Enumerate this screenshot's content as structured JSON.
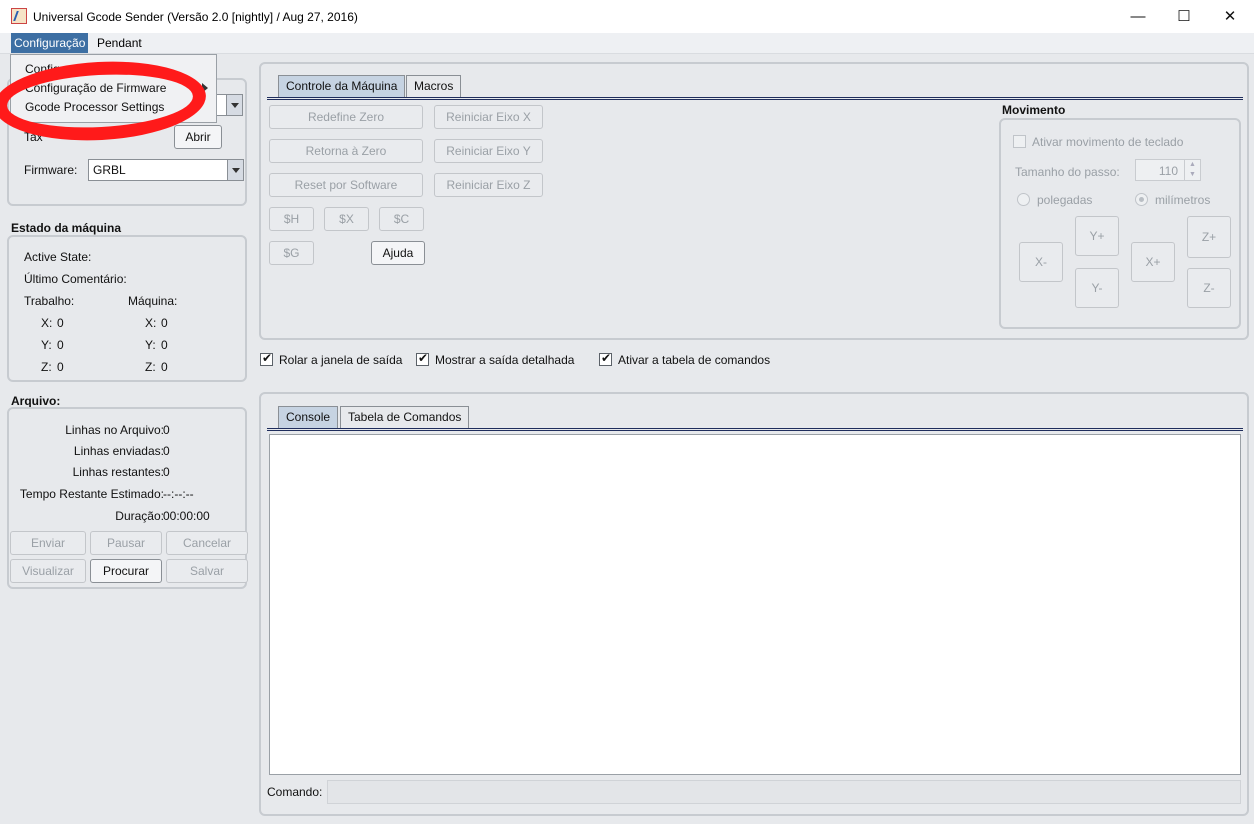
{
  "window": {
    "title": "Universal Gcode Sender (Versão 2.0 [nightly]  / Aug 27, 2016)",
    "minimize_label": "—",
    "maximize_label": "☐",
    "close_label": "✕"
  },
  "menubar": {
    "items": [
      "Configuração",
      "Pendant"
    ]
  },
  "dropdown": {
    "items": [
      "Configuração de Envio",
      "Configuração de Firmware",
      "Gcode Processor Settings"
    ]
  },
  "connection": {
    "port_label": "Tax",
    "open_button": "Abrir",
    "firmware_label": "Firmware:",
    "firmware_value": "GRBL"
  },
  "machine_state": {
    "title": "Estado da máquina",
    "active_state_label": "Active State:",
    "last_comment_label": "Último Comentário:",
    "work_label": "Trabalho:",
    "machine_label": "Máquina:",
    "work": {
      "x_label": "X:",
      "x": "0",
      "y_label": "Y:",
      "y": "0",
      "z_label": "Z:",
      "z": "0"
    },
    "machine": {
      "x_label": "X:",
      "x": "0",
      "y_label": "Y:",
      "y": "0",
      "z_label": "Z:",
      "z": "0"
    }
  },
  "file": {
    "title": "Arquivo:",
    "rows": [
      {
        "label": "Linhas no Arquivo:",
        "value": "0"
      },
      {
        "label": "Linhas enviadas:",
        "value": "0"
      },
      {
        "label": "Linhas restantes:",
        "value": "0"
      },
      {
        "label": "Tempo Restante Estimado:",
        "value": "--:--:--"
      },
      {
        "label": "Duração:",
        "value": "00:00:00"
      }
    ],
    "buttons": [
      "Enviar",
      "Pausar",
      "Cancelar",
      "Visualizar",
      "Procurar",
      "Salvar"
    ]
  },
  "machine_control": {
    "tabs": [
      "Controle da Máquina",
      "Macros"
    ],
    "buttons": {
      "reset_zero": "Redefine Zero",
      "return_zero": "Retorna à Zero",
      "soft_reset": "Reset por Software",
      "reset_x": "Reiniciar Eixo X",
      "reset_y": "Reiniciar Eixo Y",
      "reset_z": "Reiniciar Eixo Z",
      "h": "$H",
      "x": "$X",
      "c": "$C",
      "g": "$G",
      "help": "Ajuda"
    }
  },
  "movement": {
    "title": "Movimento",
    "keyboard_label": "Ativar movimento de teclado",
    "step_label": "Tamanho do passo:",
    "step_value": "110",
    "inches_label": "polegadas",
    "mm_label": "milímetros",
    "jog": {
      "x_minus": "X-",
      "x_plus": "X+",
      "y_plus": "Y+",
      "y_minus": "Y-",
      "z_plus": "Z+",
      "z_minus": "Z-"
    }
  },
  "options": {
    "scroll_output": "Rolar a janela de saída",
    "verbose_output": "Mostrar a saída detalhada",
    "command_table": "Ativar a tabela de comandos"
  },
  "console": {
    "tabs": [
      "Console",
      "Tabela de Comandos"
    ],
    "command_label": "Comando:",
    "command_value": ""
  },
  "colors": {
    "menu_active": "#3d6fa3",
    "annotation_red": "#ff1a1a"
  }
}
